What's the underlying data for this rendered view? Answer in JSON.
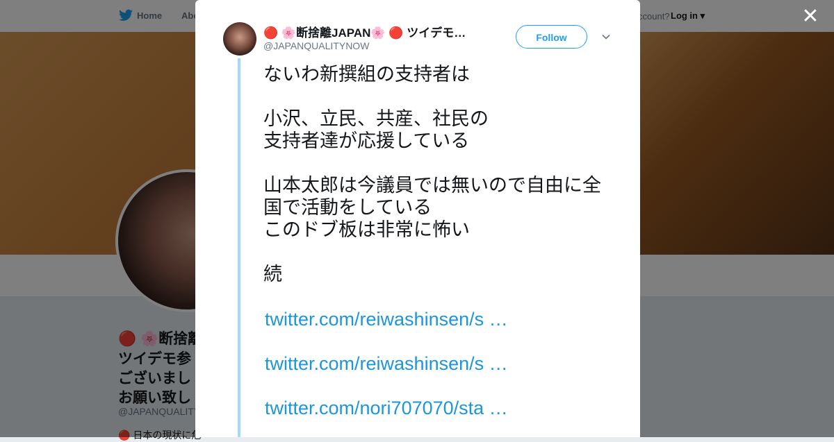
{
  "nav": {
    "home": "Home",
    "about": "Abo",
    "account_prompt": "ccount?",
    "login": "Log in"
  },
  "profile": {
    "name_line1": "🔴 🌸断捨離",
    "name_line2": "ツイデモ参",
    "name_line3": "ございまし",
    "name_line4": "お願い致し",
    "handle": "@JAPANQUALITYN",
    "desc": "🔴 日本の現状に危"
  },
  "modal": {
    "display_name": "🔴 🌸断捨離JAPAN🌸 🔴 ツイデモ…",
    "handle": "@JAPANQUALITYNOW",
    "follow_label": "Follow",
    "tweet_lines": [
      "ないわ新撰組の支持者は",
      "",
      "小沢、立民、共産、社民の",
      "支持者達が応援している",
      "",
      "山本太郎は今議員では無いので自由に全",
      "国で活動をしている",
      "このドブ板は非常に怖い",
      "",
      "続"
    ],
    "links": [
      "twitter.com/reiwashinsen/s …",
      "twitter.com/reiwashinsen/s …",
      "twitter.com/nori707070/sta …"
    ]
  },
  "colors": {
    "accent": "#1da1f2",
    "link": "#1b95e0",
    "thread_line": "#a4d9f9"
  },
  "icons": {
    "close": "close-icon",
    "caret": "chevron-down-icon",
    "bird": "twitter-bird-icon"
  }
}
